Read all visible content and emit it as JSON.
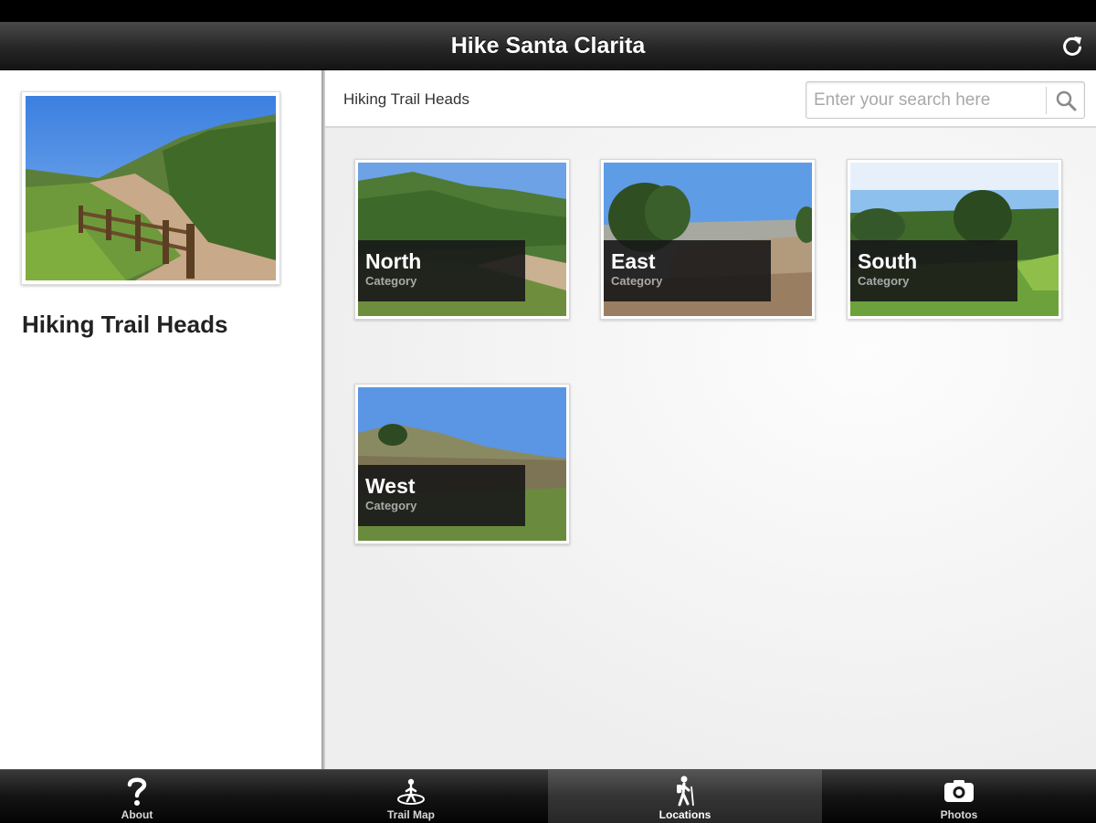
{
  "app": {
    "title": "Hike Santa Clarita"
  },
  "sidebar": {
    "heading": "Hiking Trail Heads"
  },
  "main": {
    "breadcrumb": "Hiking Trail Heads",
    "search": {
      "placeholder": "Enter your search here",
      "value": ""
    },
    "tiles": [
      {
        "name": "North",
        "subtitle": "Category"
      },
      {
        "name": "East",
        "subtitle": "Category"
      },
      {
        "name": "South",
        "subtitle": "Category"
      },
      {
        "name": "West",
        "subtitle": "Category"
      }
    ]
  },
  "tabbar": {
    "active": "Locations",
    "tabs": [
      {
        "label": "About",
        "icon": "question-icon"
      },
      {
        "label": "Trail Map",
        "icon": "map-hiker-icon"
      },
      {
        "label": "Locations",
        "icon": "hiker-icon"
      },
      {
        "label": "Photos",
        "icon": "camera-icon"
      }
    ]
  },
  "colors": {
    "title_bar": "#262626",
    "tab_bar": "#141414",
    "tile_label_bg": "#181818",
    "sky": "#4a86d8",
    "hill_green": "#4d7a32"
  }
}
